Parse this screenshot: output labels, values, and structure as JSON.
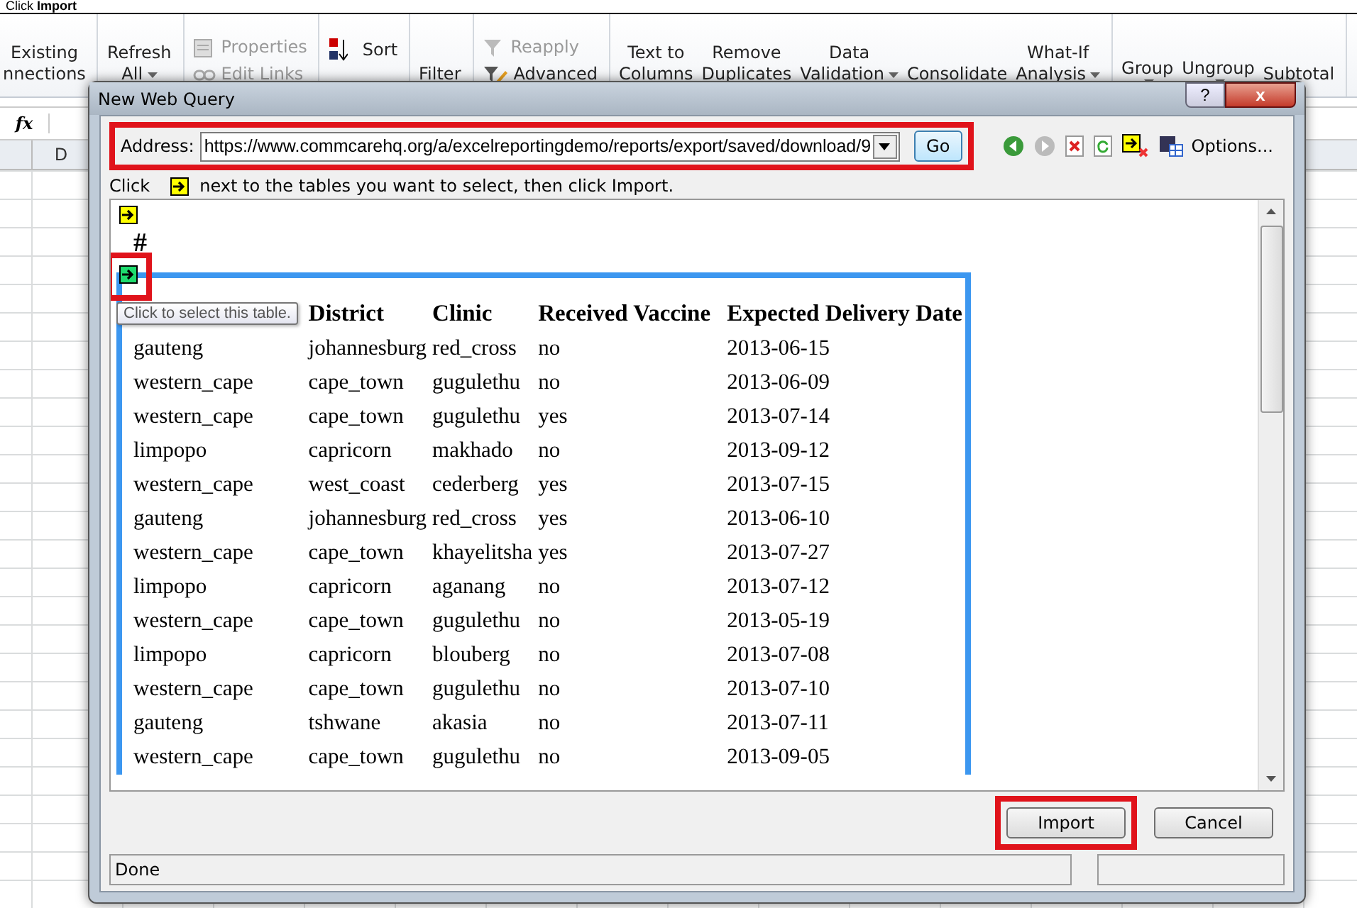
{
  "caption": "Click **Import**",
  "ribbon": {
    "groups": [
      {
        "kind": "large",
        "items": [
          {
            "label": "Existing",
            "label2": "nnections",
            "dropdown": false
          }
        ]
      },
      {
        "kind": "large",
        "items": [
          {
            "label": "Refresh",
            "label2": "All",
            "dropdown": true
          }
        ]
      },
      {
        "kind": "small",
        "items": [
          {
            "label": "Properties"
          },
          {
            "label": "Edit Links"
          }
        ]
      },
      {
        "kind": "sort",
        "items": [
          {
            "label": "Sort"
          }
        ]
      },
      {
        "kind": "large",
        "items": [
          {
            "label": "Filter",
            "dropdown": false
          }
        ]
      },
      {
        "kind": "small",
        "items": [
          {
            "label": "Reapply"
          },
          {
            "label": "Advanced"
          }
        ]
      },
      {
        "kind": "large",
        "items": [
          {
            "label": "Text to",
            "label2": "Columns",
            "dropdown": false
          },
          {
            "label": "Remove",
            "label2": "Duplicates",
            "dropdown": false
          },
          {
            "label": "Data",
            "label2": "Validation",
            "dropdown": true
          },
          {
            "label": "Consolidate",
            "dropdown": false
          },
          {
            "label": "What-If",
            "label2": "Analysis",
            "dropdown": true
          }
        ]
      },
      {
        "kind": "large",
        "items": [
          {
            "label": "Group",
            "dropdown": true
          },
          {
            "label": "Ungroup",
            "dropdown": true
          },
          {
            "label": "Subtotal",
            "dropdown": false
          }
        ]
      }
    ]
  },
  "formula_bar": {
    "fx": "fx"
  },
  "column_header": "D",
  "dialog": {
    "title": "New Web Query",
    "help": "?",
    "close": "x",
    "address": {
      "label": "Address:",
      "value": "https://www.commcarehq.org/a/excelreportingdemo/reports/export/saved/download/9"
    },
    "go": "Go",
    "options": "Options...",
    "hint": {
      "before": "Click",
      "after": "next to the tables you want to select, then click Import."
    },
    "markers": [
      {
        "selected": false
      },
      {
        "selected": true
      }
    ],
    "heading": "#",
    "tooltip": "Click to select this table.",
    "table": {
      "columns": [
        "",
        "District",
        "Clinic",
        "Received Vaccine",
        "Expected Delivery Date"
      ],
      "rows": [
        [
          "gauteng",
          "johannesburg",
          "red_cross",
          "no",
          "2013-06-15"
        ],
        [
          "western_cape",
          "cape_town",
          "gugulethu",
          "no",
          "2013-06-09"
        ],
        [
          "western_cape",
          "cape_town",
          "gugulethu",
          "yes",
          "2013-07-14"
        ],
        [
          "limpopo",
          "capricorn",
          "makhado",
          "no",
          "2013-09-12"
        ],
        [
          "western_cape",
          "west_coast",
          "cederberg",
          "yes",
          "2013-07-15"
        ],
        [
          "gauteng",
          "johannesburg",
          "red_cross",
          "yes",
          "2013-06-10"
        ],
        [
          "western_cape",
          "cape_town",
          "khayelitsha",
          "yes",
          "2013-07-27"
        ],
        [
          "limpopo",
          "capricorn",
          "aganang",
          "no",
          "2013-07-12"
        ],
        [
          "western_cape",
          "cape_town",
          "gugulethu",
          "no",
          "2013-05-19"
        ],
        [
          "limpopo",
          "capricorn",
          "blouberg",
          "no",
          "2013-07-08"
        ],
        [
          "western_cape",
          "cape_town",
          "gugulethu",
          "no",
          "2013-07-10"
        ],
        [
          "gauteng",
          "tshwane",
          "akasia",
          "no",
          "2013-07-11"
        ],
        [
          "western_cape",
          "cape_town",
          "gugulethu",
          "no",
          "2013-09-05"
        ]
      ]
    },
    "buttons": [
      {
        "label": "Import",
        "highlighted": true
      },
      {
        "label": "Cancel",
        "highlighted": false
      }
    ],
    "status": "Done"
  }
}
